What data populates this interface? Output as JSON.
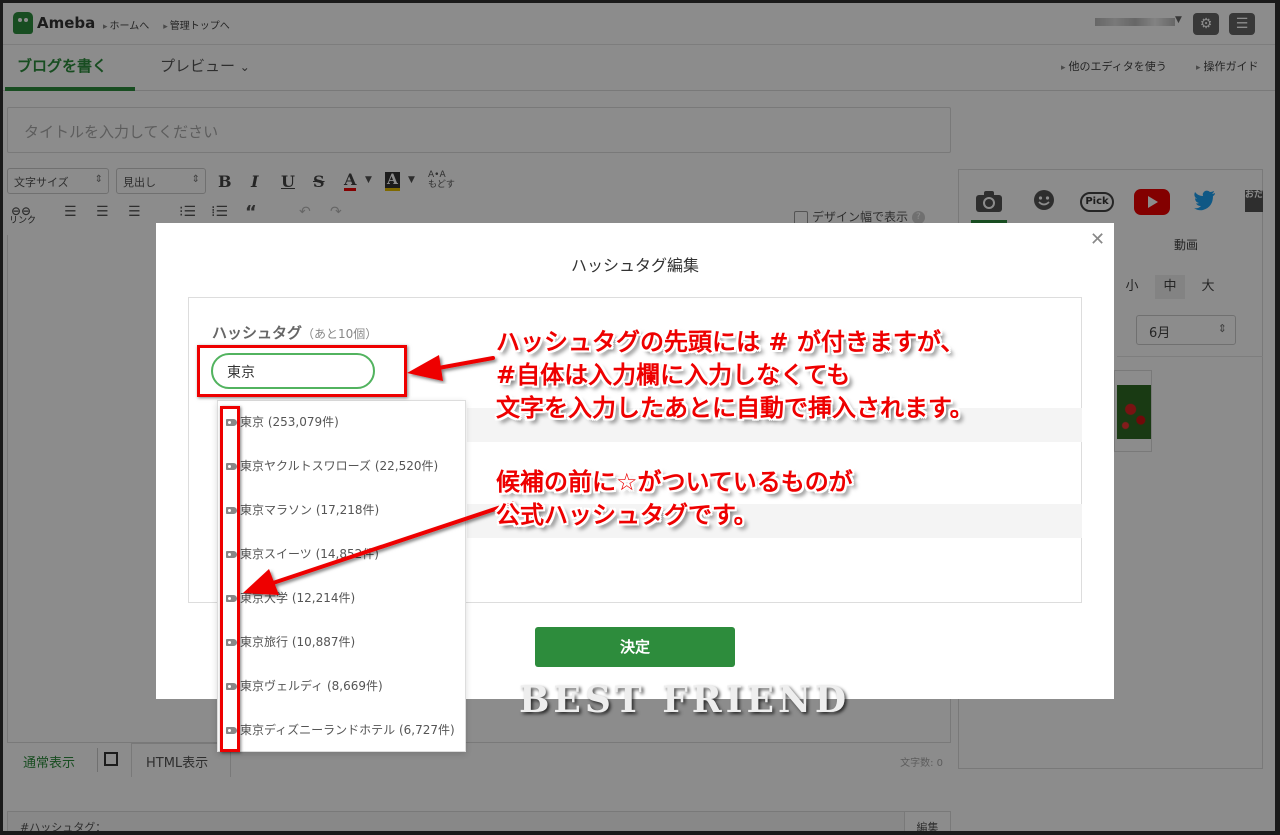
{
  "header": {
    "logo_text": "Ameba",
    "links": [
      "ホームへ",
      "管理トップへ"
    ],
    "settings_icon": "gear-icon",
    "menu_icon": "hamburger-icon"
  },
  "tabs": {
    "write": "ブログを書く",
    "preview": "プレビュー",
    "other_editor": "他のエディタを使う",
    "guide": "操作ガイド"
  },
  "editor": {
    "title_placeholder": "タイトルを入力してください",
    "font_size_select": "文字サイズ",
    "heading_select": "見出し",
    "bold": "B",
    "italic": "I",
    "underline": "U",
    "strike": "S",
    "font_color": "A",
    "bg_color": "A",
    "reset_label": "もどす",
    "link_label": "リンク",
    "design_width": "デザイン幅で表示",
    "normal_view": "通常表示",
    "html_view": "HTML表示",
    "char_count": "文字数: 0",
    "hashtag_label": "#ハッシュタグ：",
    "hashtag_edit": "編集"
  },
  "right_panel": {
    "icons": [
      "camera-icon",
      "emoji-icon",
      "pick-icon",
      "youtube-icon",
      "twitter-icon"
    ],
    "pick_label": "Pick",
    "video_label": "動画",
    "sizes": [
      "小",
      "中",
      "大"
    ],
    "selected_size": "中",
    "month": "6月"
  },
  "modal": {
    "title": "ハッシュタグ編集",
    "hashtag_label": "ハッシュタグ",
    "remaining": "（あと10個）",
    "input_value": "東京",
    "ok_button": "決定",
    "suggestions": [
      "東京 (253,079件)",
      "東京ヤクルトスワローズ (22,520件)",
      "東京マラソン (17,218件)",
      "東京スイーツ (14,852件)",
      "東京大学 (12,214件)",
      "東京旅行 (10,887件)",
      "東京ヴェルディ (8,669件)",
      "東京ディズニーランドホテル (6,727件)"
    ]
  },
  "annotations": {
    "note1_line1": "ハッシュタグの先頭には # が付きますが、",
    "note1_line2": "#自体は入力欄に入力しなくても",
    "note1_line3": "文字を入力したあとに自動で挿入されます。",
    "note2_line1": "候補の前に☆がついているものが",
    "note2_line2": "公式ハッシュタグです。",
    "annotation_color": "#e00000"
  },
  "watermark": "BEST FRIEND",
  "colors": {
    "brand_green": "#2d8c3c",
    "input_border": "#52b35f"
  }
}
